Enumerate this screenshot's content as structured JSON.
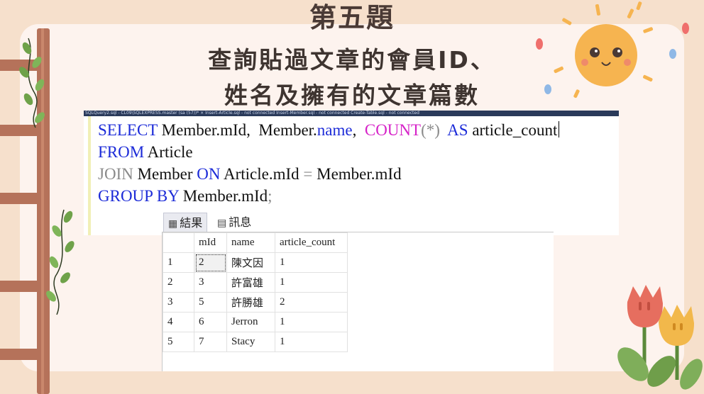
{
  "slide": {
    "title": "第五題",
    "subtitle_line1": "查詢貼過文章的會員ID、",
    "subtitle_line2": "姓名及擁有的文章篇數"
  },
  "editor": {
    "tab_strip_text": "SQLQuery2.sql - CL09\\SQLEXPRESS.master (sa (57))*  ×   Insert-Article.sql - not connected     Insert-Member.sql - not connected     Create-Table.sql - not connected",
    "lines": [
      {
        "kw1": "SELECT",
        "rest1": " Member.",
        "kw2": "mId",
        "rest2": ",  Member.",
        "kw3": "name",
        "rest3": ",  ",
        "fn": "COUNT",
        "rest4": "(*)  ",
        "kw4": "AS",
        "rest5": " article_count"
      },
      {
        "kw1": "FROM",
        "rest1": " Article"
      },
      {
        "op1": "JOIN",
        "rest1": " Member ",
        "kw2": "ON",
        "rest2": " Article.mId ",
        "op2": "=",
        "rest3": " Member.mId"
      },
      {
        "kw1": "GROUP BY",
        "rest1": " Member.mId",
        "op1": ";"
      }
    ]
  },
  "results": {
    "tabs": {
      "results_label": "結果",
      "messages_label": "訊息"
    },
    "columns": [
      "",
      "mId",
      "name",
      "article_count"
    ],
    "rows": [
      {
        "n": "1",
        "mId": "2",
        "name": "陳文因",
        "article_count": "1"
      },
      {
        "n": "2",
        "mId": "3",
        "name": "許富雄",
        "article_count": "1"
      },
      {
        "n": "3",
        "mId": "5",
        "name": "許勝雄",
        "article_count": "2"
      },
      {
        "n": "4",
        "mId": "6",
        "name": "Jerron",
        "article_count": "1"
      },
      {
        "n": "5",
        "mId": "7",
        "name": "Stacy",
        "article_count": "1"
      }
    ]
  },
  "decorations": {
    "ladder_color": "#b5725a",
    "leaf_color": "#6fa24a",
    "sun_color": "#f6b450",
    "tulip_red": "#e66e5f",
    "tulip_yellow": "#f2b84b"
  }
}
